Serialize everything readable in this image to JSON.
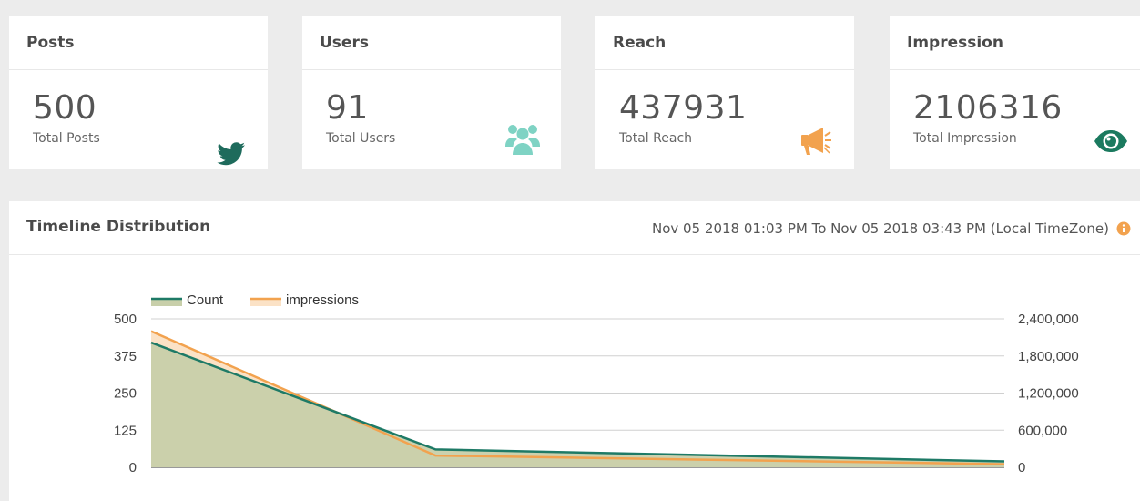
{
  "cards": [
    {
      "title": "Posts",
      "value": "500",
      "label": "Total Posts",
      "icon": "twitter-icon",
      "color": "#1e6b5c"
    },
    {
      "title": "Users",
      "value": "91",
      "label": "Total Users",
      "icon": "users-icon",
      "color": "#7fd3c4"
    },
    {
      "title": "Reach",
      "value": "437931",
      "label": "Total Reach",
      "icon": "megaphone-icon",
      "color": "#f2a24e"
    },
    {
      "title": "Impression",
      "value": "2106316",
      "label": "Total Impression",
      "icon": "eye-icon",
      "color": "#1b7a5f"
    }
  ],
  "timeline": {
    "title": "Timeline Distribution",
    "range": "Nov 05 2018 01:03 PM To Nov 05 2018 03:43 PM (Local TimeZone)",
    "info_icon": "info-icon",
    "info_color": "#f2a24e"
  },
  "chart_data": {
    "type": "area",
    "x": [
      "1",
      "2",
      "3",
      "4"
    ],
    "series": [
      {
        "name": "Count",
        "axis": "left",
        "values": [
          420,
          60,
          40,
          20
        ],
        "color": "#1e7a66",
        "fill": "#c8cfaa"
      },
      {
        "name": "impressions",
        "axis": "right",
        "values": [
          2200000,
          190000,
          120000,
          50000
        ],
        "color": "#f2a24e",
        "fill": "#fbe2c6"
      }
    ],
    "ylim_left": [
      0,
      500
    ],
    "yticks_left": [
      "500",
      "375",
      "250",
      "125",
      "0"
    ],
    "ylim_right": [
      0,
      2400000
    ],
    "yticks_right": [
      "2,400,000",
      "1,800,000",
      "1,200,000",
      "600,000",
      "0"
    ],
    "legend": "top-left",
    "grid": true
  }
}
